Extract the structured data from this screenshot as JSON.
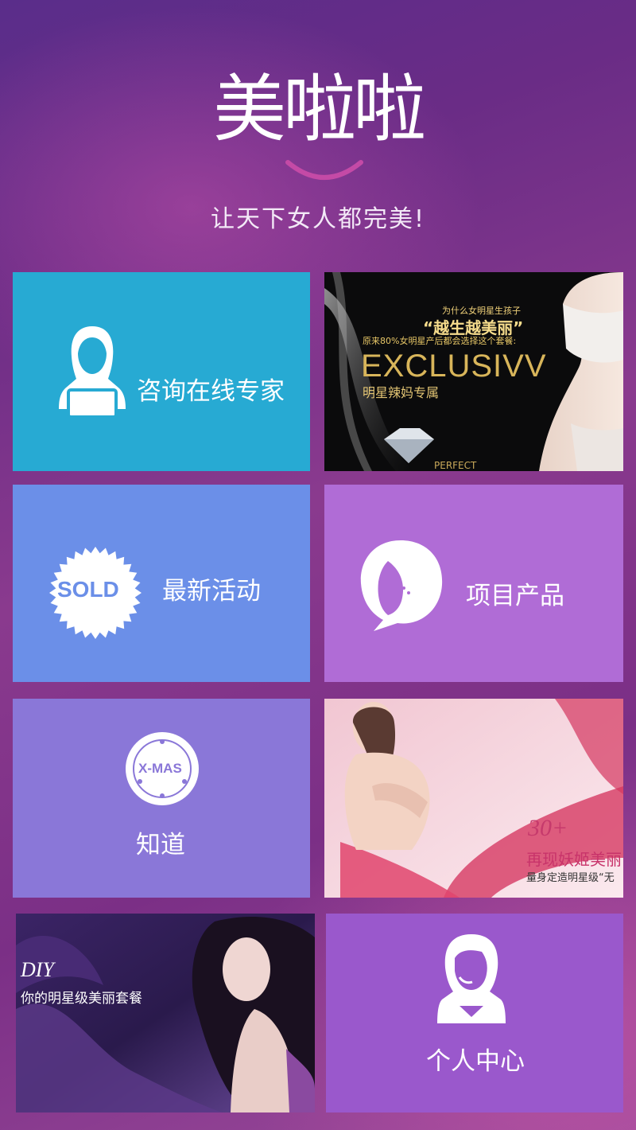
{
  "header": {
    "logo_text": "美啦啦",
    "slogan": "让天下女人都完美!"
  },
  "tiles": {
    "consult": {
      "label": "咨询在线专家",
      "icon": "expert-person-icon",
      "color": "#27aad3"
    },
    "banner_exclusive": {
      "top_line": "为什么女明星生孩子",
      "quote": "“越生越美丽”",
      "sub_line": "原来80%女明星产后都会选择这个套餐:",
      "brand": "EXCLUSIVV",
      "tagline": "明星辣妈专属",
      "footer": "PERFECT"
    },
    "activity": {
      "label": "最新活动",
      "badge_text": "SOLD",
      "icon": "sold-badge-icon",
      "color": "#6b8fe8"
    },
    "products": {
      "label": "项目产品",
      "icon": "woman-face-icon",
      "color": "#b06cd6"
    },
    "knowledge": {
      "label": "知道",
      "badge_text": "X-MAS",
      "icon": "xmas-badge-icon",
      "color": "#8a77d8"
    },
    "banner_30plus": {
      "headline": "30+",
      "title": "再现妖姬美丽",
      "subtitle": "量身定造明星级“无"
    },
    "banner_diy": {
      "headline": "DIY",
      "subtitle": "你的明星级美丽套餐"
    },
    "profile": {
      "label": "个人中心",
      "icon": "woman-headset-icon",
      "color": "#9a58cc"
    }
  }
}
